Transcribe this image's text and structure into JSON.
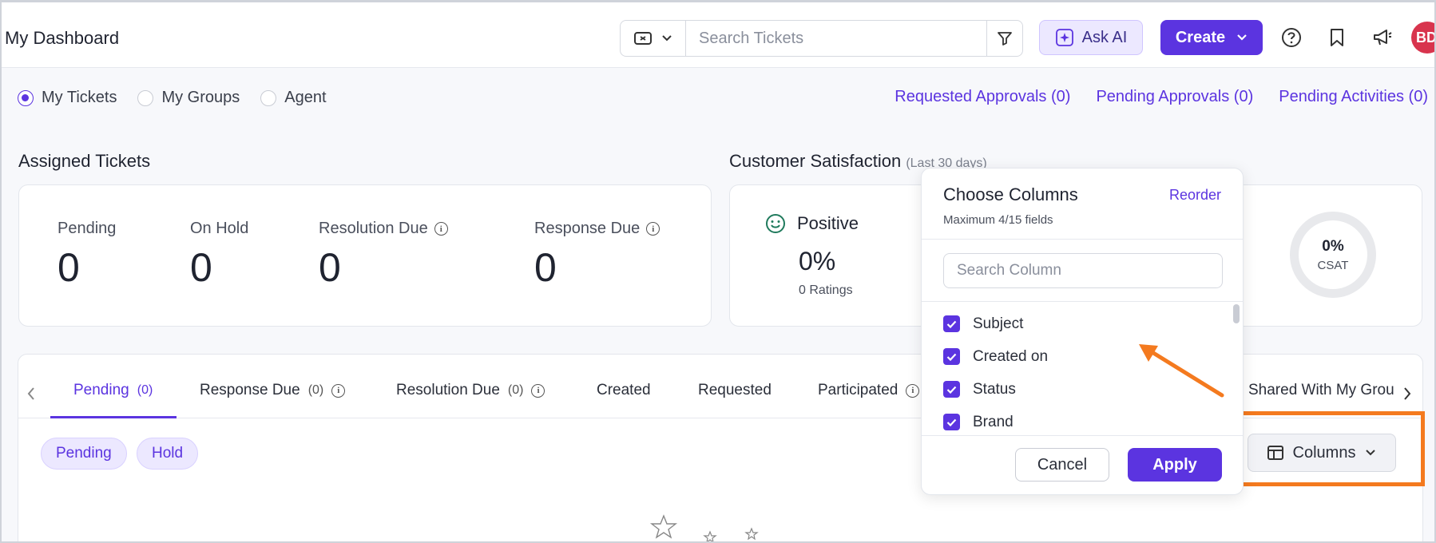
{
  "header": {
    "title": "My Dashboard",
    "search_placeholder": "Search Tickets",
    "ask_ai_label": "Ask AI",
    "create_label": "Create",
    "avatar_initials": "BD"
  },
  "scope": {
    "options": [
      "My Tickets",
      "My Groups",
      "Agent"
    ],
    "selected": "My Tickets"
  },
  "links": {
    "requested": "Requested Approvals (0)",
    "pending": "Pending Approvals (0)",
    "activities": "Pending Activities (0)"
  },
  "assigned": {
    "title": "Assigned Tickets",
    "stats": [
      {
        "label": "Pending",
        "value": "0"
      },
      {
        "label": "On Hold",
        "value": "0"
      },
      {
        "label": "Resolution Due",
        "value": "0"
      },
      {
        "label": "Response Due",
        "value": "0"
      }
    ]
  },
  "csat": {
    "title": "Customer Satisfaction",
    "subtitle": "(Last 30 days)",
    "positive_label": "Positive",
    "positive_value": "0%",
    "ratings": "0 Ratings",
    "ring_value": "0%",
    "ring_label": "CSAT"
  },
  "tabs": [
    {
      "label": "Pending",
      "count": "(0)"
    },
    {
      "label": "Response Due",
      "count": "(0)"
    },
    {
      "label": "Resolution Due",
      "count": "(0)"
    },
    {
      "label": "Created",
      "count": ""
    },
    {
      "label": "Requested",
      "count": ""
    },
    {
      "label": "Participated",
      "count": ""
    },
    {
      "label": "Shared With My Grou",
      "count": ""
    }
  ],
  "chips": [
    "Pending",
    "Hold"
  ],
  "columns_button": "Columns",
  "popover": {
    "title": "Choose Columns",
    "reorder": "Reorder",
    "subtitle": "Maximum 4/15 fields",
    "search_placeholder": "Search Column",
    "items": [
      "Subject",
      "Created on",
      "Status",
      "Brand"
    ],
    "cancel": "Cancel",
    "apply": "Apply"
  },
  "colors": {
    "accent": "#5b34e0",
    "highlight": "#f47a1f"
  }
}
